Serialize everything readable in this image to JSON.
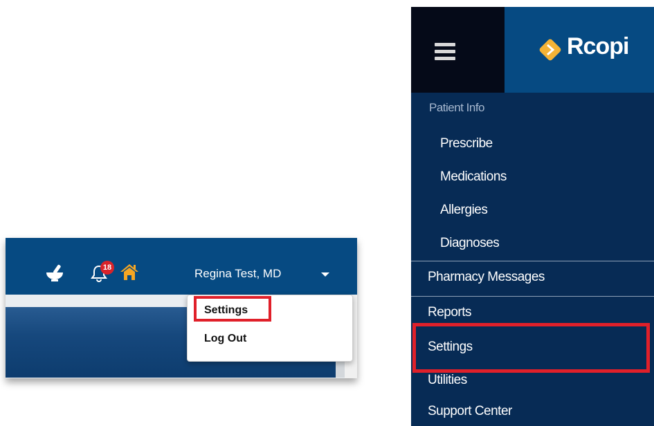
{
  "top_bar": {
    "notification_count": "18",
    "user_name": "Regina Test, MD",
    "icons": [
      "mortar-pestle-icon",
      "bell-icon",
      "home-icon",
      "caret-down-icon"
    ],
    "colors": {
      "bar": "#064a82",
      "badge": "#d8232a",
      "home": "#f5a623",
      "highlight": "#e0202a"
    }
  },
  "dropdown": {
    "items": [
      "Settings",
      "Log Out"
    ],
    "highlighted": "Settings"
  },
  "sidebar": {
    "brand": "Rcopi",
    "section_label": "Patient Info",
    "sub_items": [
      "Prescribe",
      "Medications",
      "Allergies",
      "Diagnoses"
    ],
    "items": [
      "Pharmacy Messages",
      "Reports",
      "Settings",
      "Utilities",
      "Support Center"
    ],
    "highlighted": "Settings",
    "colors": {
      "background": "#072b55",
      "header": "#064a82",
      "logo": "#f5b335"
    }
  }
}
